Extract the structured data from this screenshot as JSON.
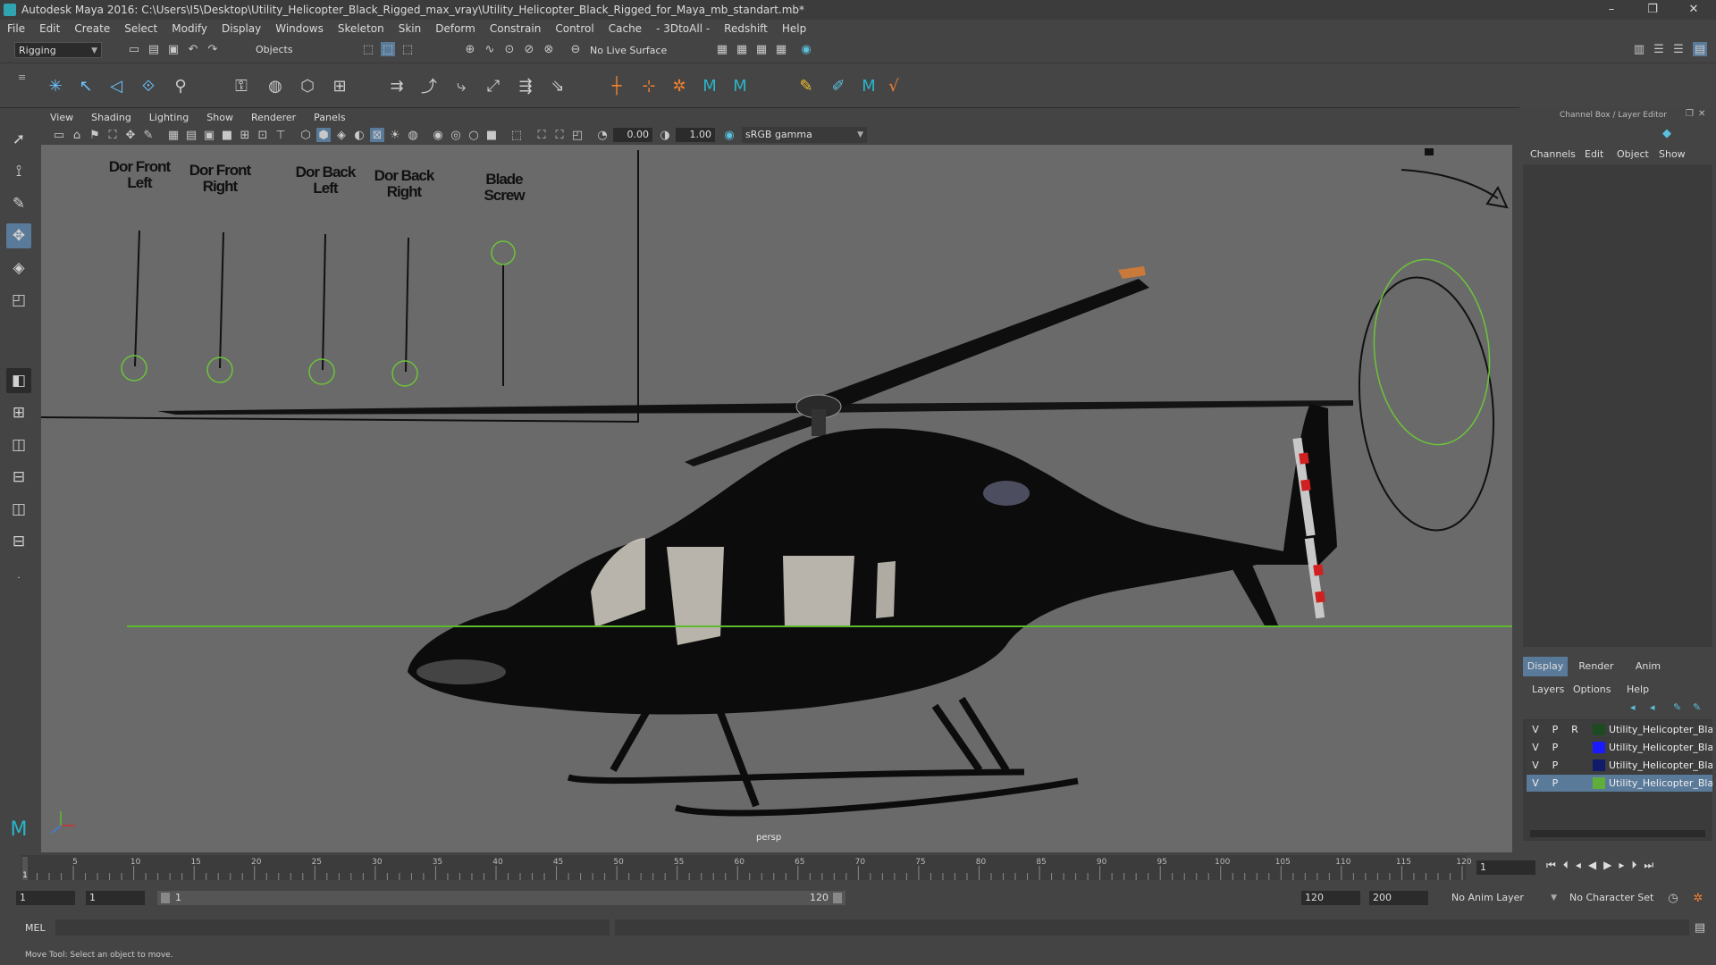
{
  "window": {
    "title": "Autodesk Maya 2016: C:\\Users\\I5\\Desktop\\Utility_Helicopter_Black_Rigged_max_vray\\Utility_Helicopter_Black_Rigged_for_Maya_mb_standart.mb*",
    "minimize": "–",
    "maximize": "❐",
    "close": "✕"
  },
  "menubar": [
    "File",
    "Edit",
    "Create",
    "Select",
    "Modify",
    "Display",
    "Windows",
    "Skeleton",
    "Skin",
    "Deform",
    "Constrain",
    "Control",
    "Cache",
    "- 3DtoAll -",
    "Redshift",
    "Help"
  ],
  "statusline": {
    "mode": "Rigging",
    "selection_mask": "Objects",
    "live_surface": "No Live Surface"
  },
  "viewport": {
    "menus": [
      "View",
      "Shading",
      "Lighting",
      "Show",
      "Renderer",
      "Panels"
    ],
    "exposure": "0.00",
    "gamma": "1.00",
    "color_space": "sRGB gamma",
    "camera": "persp",
    "controls": [
      {
        "label": "Dor Front\nLeft"
      },
      {
        "label": "Dor Front\nRight"
      },
      {
        "label": "Dor Back\nLeft"
      },
      {
        "label": "Dor Back\nRight"
      },
      {
        "label": "Blade\nScrew"
      }
    ]
  },
  "channelbox": {
    "title": "Channel Box / Layer Editor",
    "menus": [
      "Channels",
      "Edit",
      "Object",
      "Show"
    ]
  },
  "layers": {
    "tabs": [
      "Display",
      "Render",
      "Anim"
    ],
    "menus": [
      "Layers",
      "Options",
      "Help"
    ],
    "rows": [
      {
        "v": "V",
        "p": "P",
        "r": "R",
        "color": "#1e4a22",
        "name": "Utility_Helicopter_Blac",
        "selected": false
      },
      {
        "v": "V",
        "p": "P",
        "r": "",
        "color": "#1a1aff",
        "name": "Utility_Helicopter_Blac",
        "selected": false
      },
      {
        "v": "V",
        "p": "P",
        "r": "",
        "color": "#121a6a",
        "name": "Utility_Helicopter_Blac",
        "selected": false
      },
      {
        "v": "V",
        "p": "P",
        "r": "",
        "color": "#5fae3a",
        "name": "Utility_Helicopter_Blac",
        "selected": true
      }
    ]
  },
  "timeline": {
    "ticks": [
      "5",
      "10",
      "15",
      "20",
      "25",
      "30",
      "35",
      "40",
      "45",
      "50",
      "55",
      "60",
      "65",
      "70",
      "75",
      "80",
      "85",
      "90",
      "95",
      "100",
      "105",
      "110",
      "115",
      "120"
    ],
    "start_tick": "1",
    "current_frame": "1"
  },
  "range": {
    "start": "1",
    "playback_start": "1",
    "slider_start": "1",
    "slider_end": "120",
    "playback_end": "120",
    "end": "200",
    "anim_layer": "No Anim Layer",
    "character_set": "No Character Set"
  },
  "cmdline": {
    "label": "MEL"
  },
  "helpline": {
    "text": "Move Tool: Select an object to move."
  }
}
